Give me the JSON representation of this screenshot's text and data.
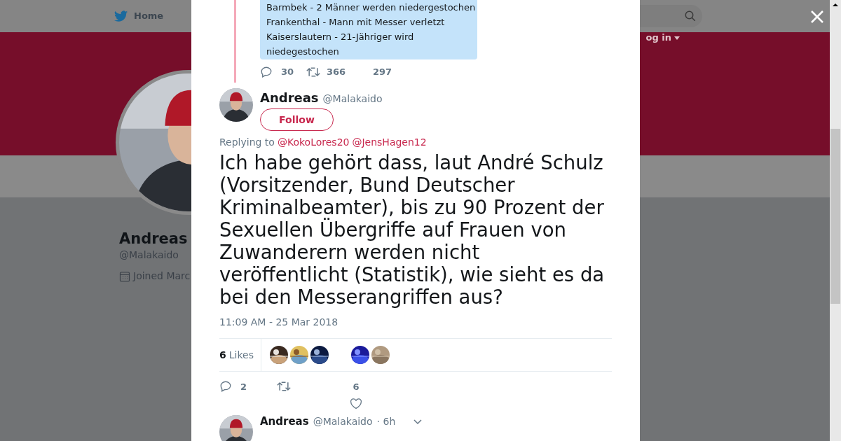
{
  "nav": {
    "home": "Home",
    "login": "og in"
  },
  "profile": {
    "name": "Andreas",
    "handle": "@Malakaido",
    "joined": "Joined Marc"
  },
  "quoted_tweet": {
    "lines": [
      "Barmbek - 2 Männer werden niedergestochen",
      "Frankenthal - Mann mit Messer verletzt",
      "Kaiserslautern - 21-Jähriger wird",
      "niedegestochen"
    ],
    "replies": "30",
    "retweets": "366",
    "likes": "297"
  },
  "tweet": {
    "name": "Andreas",
    "handle": "@Malakaido",
    "follow": "Follow",
    "replying_label": "Replying to",
    "mentions": [
      "@KokoLores20",
      "@JensHagen12"
    ],
    "text": "Ich habe gehört dass, laut André Schulz (Vorsitzender, Bund Deutscher Kriminalbeamter), bis zu 90 Prozent der Sexuellen Übergriffe auf Frauen von Zuwanderern werden nicht veröffentlicht (Statistik), wie sieht es da bei den Messerangriffen aus?",
    "timestamp": "11:09 AM - 25 Mar 2018",
    "likes_count": "6",
    "likes_label": "Likes",
    "replies": "2",
    "likes": "6"
  },
  "next_tweet": {
    "name": "Andreas",
    "handle": "@Malakaido",
    "time": "· 6h"
  }
}
